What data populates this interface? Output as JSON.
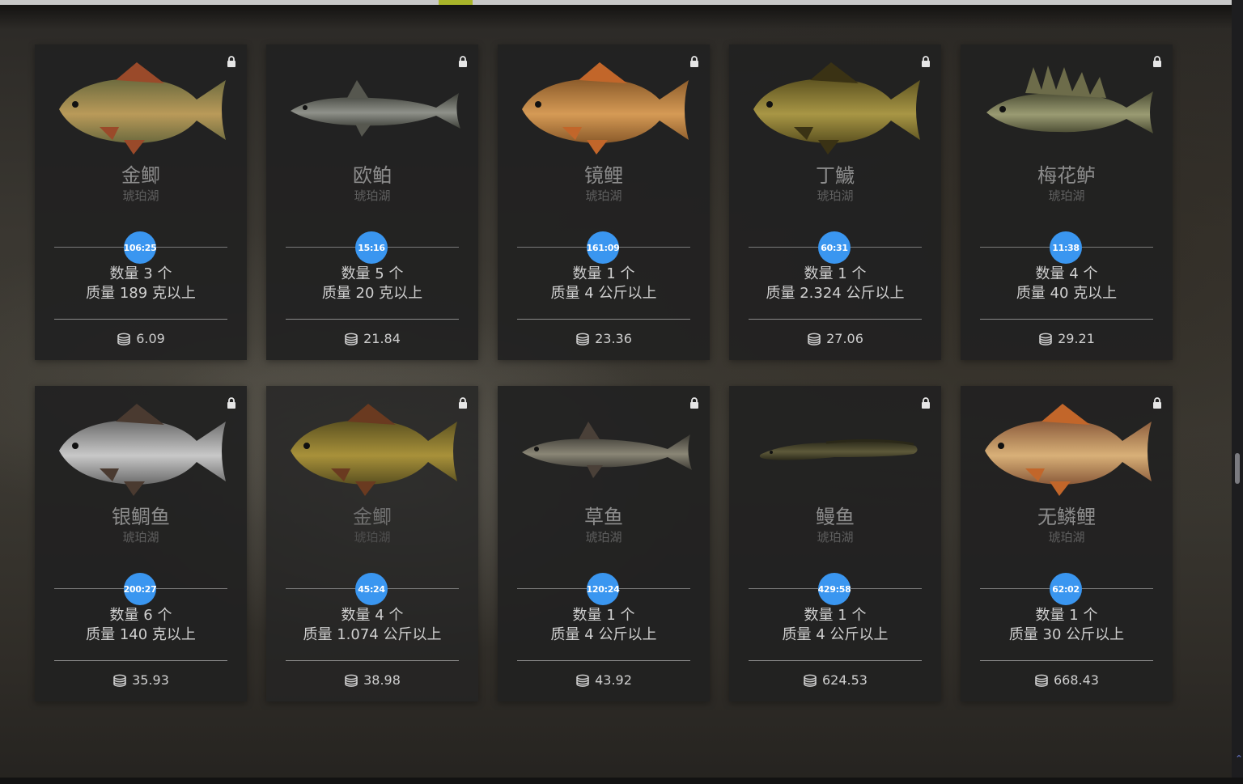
{
  "theme": {
    "badge_color": "#3a96f0",
    "accent_color": "#a9b52a",
    "card_bg": "#212121"
  },
  "labels": {
    "count_prefix": "数量",
    "count_unit": "个",
    "weight_prefix": "质量",
    "weight_suffix": "以上"
  },
  "fish": [
    {
      "name": "金鲫",
      "location": "琥珀湖",
      "timer": "106:25",
      "count": "数量 3 个",
      "weight": "质量 189 克以上",
      "price": "6.09",
      "locked": true,
      "icon": "crucian-carp-image",
      "palette": [
        "#6b6a3e",
        "#b99a59",
        "#9a4a2a"
      ]
    },
    {
      "name": "欧鲌",
      "location": "琥珀湖",
      "timer": "15:16",
      "count": "数量 5 个",
      "weight": "质量 20 克以上",
      "price": "21.84",
      "locked": true,
      "icon": "bleak-image",
      "palette": [
        "#3d3f38",
        "#8f918a",
        "#56574f"
      ]
    },
    {
      "name": "镜鲤",
      "location": "琥珀湖",
      "timer": "161:09",
      "count": "数量 1 个",
      "weight": "质量 4 公斤以上",
      "price": "23.36",
      "locked": true,
      "icon": "mirror-carp-image",
      "palette": [
        "#8a5a2a",
        "#d59a55",
        "#c2662a"
      ]
    },
    {
      "name": "丁鱥",
      "location": "琥珀湖",
      "timer": "60:31",
      "count": "数量 1 个",
      "weight": "质量 2.324 公斤以上",
      "price": "27.06",
      "locked": true,
      "icon": "tench-image",
      "palette": [
        "#5c5220",
        "#a89645",
        "#3a3214"
      ]
    },
    {
      "name": "梅花鲈",
      "location": "琥珀湖",
      "timer": "11:38",
      "count": "数量 4 个",
      "weight": "质量 40 克以上",
      "price": "29.21",
      "locked": true,
      "icon": "ruffe-image",
      "palette": [
        "#4a4b33",
        "#9a9b72",
        "#6d6c4a"
      ]
    },
    {
      "name": "银鲷鱼",
      "location": "琥珀湖",
      "timer": "200:27",
      "count": "数量 6 个",
      "weight": "质量 140 克以上",
      "price": "35.93",
      "locked": true,
      "icon": "silver-bream-image",
      "palette": [
        "#6a6a6a",
        "#c8c8c8",
        "#4a3a30"
      ]
    },
    {
      "name": "金鲫",
      "location": "琥珀湖",
      "timer": "45:24",
      "count": "数量 4 个",
      "weight": "质量 1.074 公斤以上",
      "price": "38.98",
      "locked": true,
      "icon": "crucian-carp-image",
      "palette": [
        "#5a5020",
        "#a8913a",
        "#6a3a20"
      ]
    },
    {
      "name": "草鱼",
      "location": "琥珀湖",
      "timer": "120:24",
      "count": "数量 1 个",
      "weight": "质量 4 公斤以上",
      "price": "43.92",
      "locked": true,
      "icon": "grass-carp-image",
      "palette": [
        "#3c3a34",
        "#8a8676",
        "#4a4038"
      ]
    },
    {
      "name": "鳗鱼",
      "location": "琥珀湖",
      "timer": "429:58",
      "count": "数量 1 个",
      "weight": "质量 4 公斤以上",
      "price": "624.53",
      "locked": true,
      "icon": "eel-image",
      "palette": [
        "#2e2c1c",
        "#5e5a3a",
        "#2a2818"
      ]
    },
    {
      "name": "无鳞鲤",
      "location": "琥珀湖",
      "timer": "62:02",
      "count": "数量 1 个",
      "weight": "质量 30 公斤以上",
      "price": "668.43",
      "locked": true,
      "icon": "leather-carp-image",
      "palette": [
        "#8a5a3a",
        "#d8b078",
        "#c2662a"
      ]
    }
  ]
}
